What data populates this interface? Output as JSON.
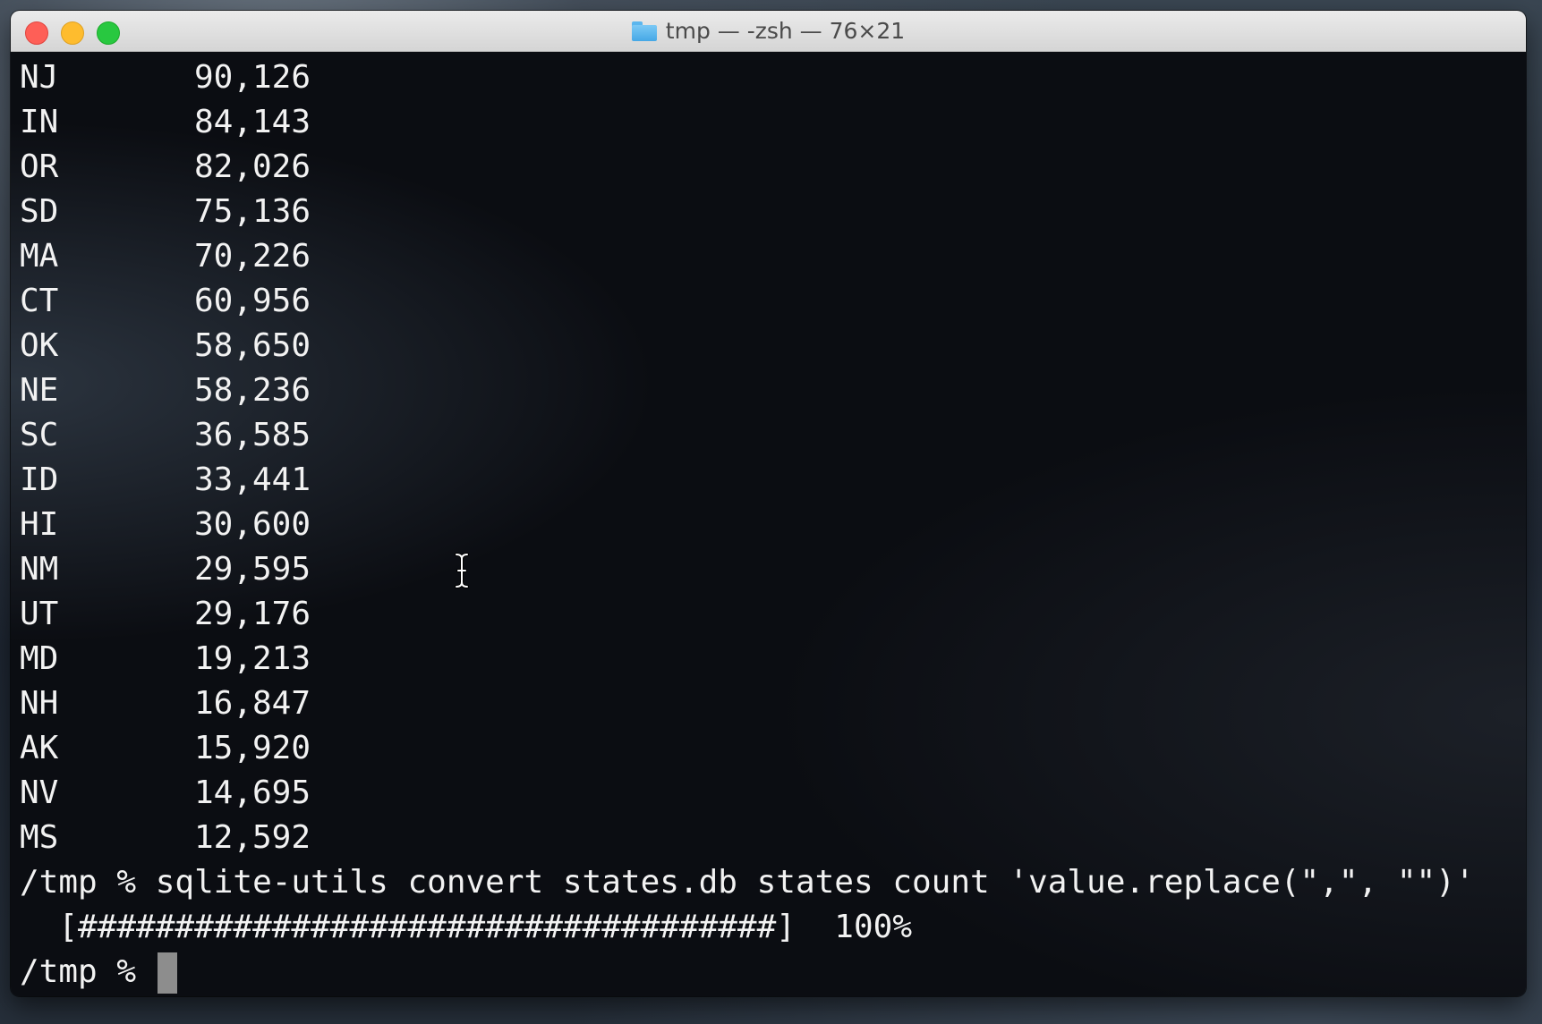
{
  "window": {
    "title": "tmp — -zsh — 76×21"
  },
  "terminal": {
    "rows": [
      {
        "state": "NJ",
        "count": "90,126"
      },
      {
        "state": "IN",
        "count": "84,143"
      },
      {
        "state": "OR",
        "count": "82,026"
      },
      {
        "state": "SD",
        "count": "75,136"
      },
      {
        "state": "MA",
        "count": "70,226"
      },
      {
        "state": "CT",
        "count": "60,956"
      },
      {
        "state": "OK",
        "count": "58,650"
      },
      {
        "state": "NE",
        "count": "58,236"
      },
      {
        "state": "SC",
        "count": "36,585"
      },
      {
        "state": "ID",
        "count": "33,441"
      },
      {
        "state": "HI",
        "count": "30,600"
      },
      {
        "state": "NM",
        "count": "29,595"
      },
      {
        "state": "UT",
        "count": "29,176"
      },
      {
        "state": "MD",
        "count": "19,213"
      },
      {
        "state": "NH",
        "count": "16,847"
      },
      {
        "state": "AK",
        "count": "15,920"
      },
      {
        "state": "NV",
        "count": "14,695"
      },
      {
        "state": "MS",
        "count": "12,592"
      }
    ],
    "command_line": "/tmp % sqlite-utils convert states.db states count 'value.replace(\",\", \"\")'",
    "progress_line": "  [####################################]  100%",
    "progress_percent": 100,
    "prompt": "/tmp % "
  },
  "icons": {
    "title": "folder-icon",
    "pointer": "text-cursor-icon"
  },
  "colors": {
    "terminal_bg": "#0b0d12",
    "terminal_fg": "#f2f2f2",
    "close": "#fe5f57",
    "minimize": "#febc2e",
    "maximize": "#28c840"
  }
}
